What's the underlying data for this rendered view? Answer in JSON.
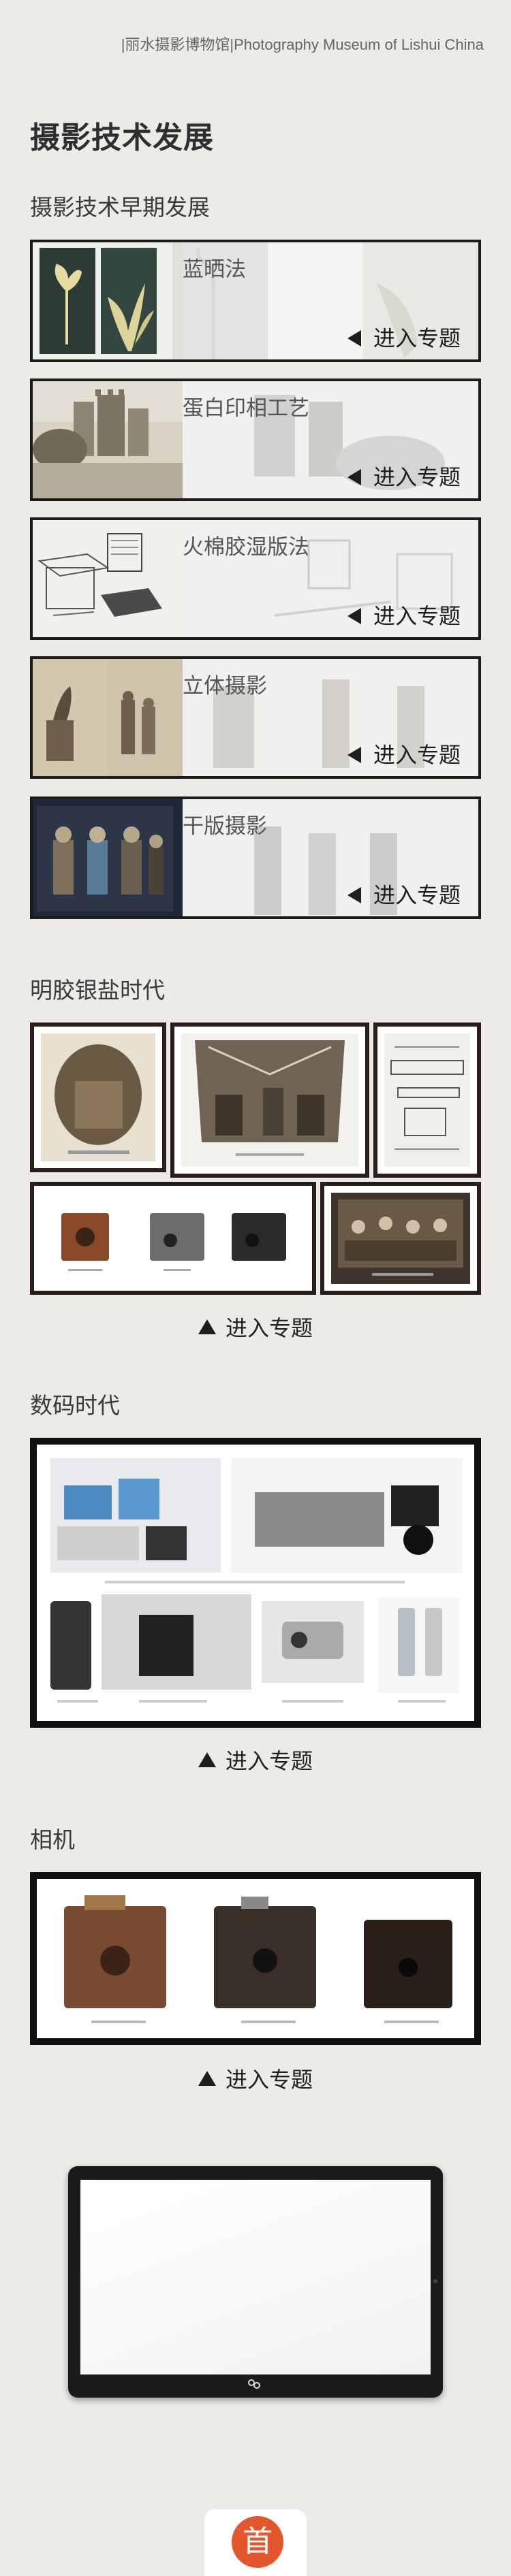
{
  "header": {
    "museum_name": "|丽水摄影博物馆|Photography Museum of Lishui China"
  },
  "page": {
    "title": "摄影技术发展"
  },
  "colors": {
    "background": "#ecebe8",
    "home_button": "#e3572f",
    "frame_dark": "#2a1e1b"
  },
  "early": {
    "title": "摄影技术早期发展",
    "enter_label": "进入专题",
    "topics": [
      {
        "label": "蓝晒法"
      },
      {
        "label": "蛋白印相工艺"
      },
      {
        "label": "火棉胶湿版法"
      },
      {
        "label": "立体摄影"
      },
      {
        "label": "干版摄影"
      }
    ]
  },
  "gelatin": {
    "title": "明胶银盐时代",
    "enter_label": "进入专题"
  },
  "digital": {
    "title": "数码时代",
    "enter_label": "进入专题"
  },
  "camera": {
    "title": "相机",
    "enter_label": "进入专题"
  },
  "footer": {
    "home_label": "首",
    "home_icon": "home-icon",
    "tablet_logo": "tablet-logo-icon"
  }
}
